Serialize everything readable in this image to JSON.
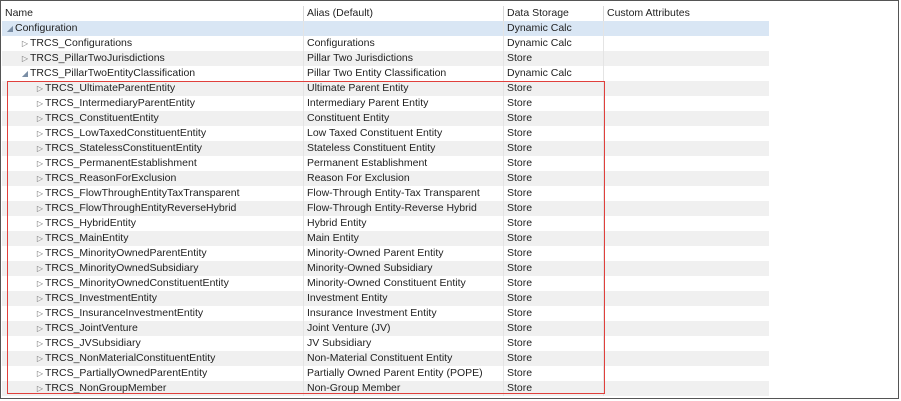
{
  "columns": {
    "name": "Name",
    "alias": "Alias (Default)",
    "storage": "Data Storage",
    "attributes": "Custom Attributes"
  },
  "rows": [
    {
      "name": "Configuration",
      "alias": "",
      "storage": "Dynamic Calc",
      "level": 0,
      "expanded": true
    },
    {
      "name": "TRCS_Configurations",
      "alias": "Configurations",
      "storage": "Dynamic Calc",
      "level": 1,
      "expanded": false
    },
    {
      "name": "TRCS_PillarTwoJurisdictions",
      "alias": "Pillar Two Jurisdictions",
      "storage": "Store",
      "level": 1,
      "expanded": false
    },
    {
      "name": "TRCS_PillarTwoEntityClassification",
      "alias": "Pillar Two Entity Classification",
      "storage": "Dynamic Calc",
      "level": 1,
      "expanded": true
    },
    {
      "name": "TRCS_UltimateParentEntity",
      "alias": "Ultimate Parent Entity",
      "storage": "Store",
      "level": 2,
      "expanded": false
    },
    {
      "name": "TRCS_IntermediaryParentEntity",
      "alias": "Intermediary Parent Entity",
      "storage": "Store",
      "level": 2,
      "expanded": false
    },
    {
      "name": "TRCS_ConstituentEntity",
      "alias": "Constituent Entity",
      "storage": "Store",
      "level": 2,
      "expanded": false
    },
    {
      "name": "TRCS_LowTaxedConstituentEntity",
      "alias": "Low Taxed Constituent Entity",
      "storage": "Store",
      "level": 2,
      "expanded": false
    },
    {
      "name": "TRCS_StatelessConstituentEntity",
      "alias": "Stateless Constituent Entity",
      "storage": "Store",
      "level": 2,
      "expanded": false
    },
    {
      "name": "TRCS_PermanentEstablishment",
      "alias": "Permanent Establishment",
      "storage": "Store",
      "level": 2,
      "expanded": false
    },
    {
      "name": "TRCS_ReasonForExclusion",
      "alias": "Reason For Exclusion",
      "storage": "Store",
      "level": 2,
      "expanded": false
    },
    {
      "name": "TRCS_FlowThroughEntityTaxTransparent",
      "alias": "Flow-Through Entity-Tax Transparent",
      "storage": "Store",
      "level": 2,
      "expanded": false
    },
    {
      "name": "TRCS_FlowThroughEntityReverseHybrid",
      "alias": "Flow-Through Entity-Reverse Hybrid",
      "storage": "Store",
      "level": 2,
      "expanded": false
    },
    {
      "name": "TRCS_HybridEntity",
      "alias": "Hybrid Entity",
      "storage": "Store",
      "level": 2,
      "expanded": false
    },
    {
      "name": "TRCS_MainEntity",
      "alias": "Main Entity",
      "storage": "Store",
      "level": 2,
      "expanded": false
    },
    {
      "name": "TRCS_MinorityOwnedParentEntity",
      "alias": "Minority-Owned Parent Entity",
      "storage": "Store",
      "level": 2,
      "expanded": false
    },
    {
      "name": "TRCS_MinorityOwnedSubsidiary",
      "alias": "Minority-Owned Subsidiary",
      "storage": "Store",
      "level": 2,
      "expanded": false
    },
    {
      "name": "TRCS_MinorityOwnedConstituentEntity",
      "alias": "Minority-Owned Constituent Entity",
      "storage": "Store",
      "level": 2,
      "expanded": false
    },
    {
      "name": "TRCS_InvestmentEntity",
      "alias": "Investment Entity",
      "storage": "Store",
      "level": 2,
      "expanded": false
    },
    {
      "name": "TRCS_InsuranceInvestmentEntity",
      "alias": "Insurance Investment Entity",
      "storage": "Store",
      "level": 2,
      "expanded": false
    },
    {
      "name": "TRCS_JointVenture",
      "alias": "Joint Venture (JV)",
      "storage": "Store",
      "level": 2,
      "expanded": false
    },
    {
      "name": "TRCS_JVSubsidiary",
      "alias": "JV Subsidiary",
      "storage": "Store",
      "level": 2,
      "expanded": false
    },
    {
      "name": "TRCS_NonMaterialConstituentEntity",
      "alias": "Non-Material Constituent Entity",
      "storage": "Store",
      "level": 2,
      "expanded": false
    },
    {
      "name": "TRCS_PartiallyOwnedParentEntity",
      "alias": "Partially Owned Parent Entity (POPE)",
      "storage": "Store",
      "level": 2,
      "expanded": false
    },
    {
      "name": "TRCS_NonGroupMember",
      "alias": "Non-Group Member",
      "storage": "Store",
      "level": 2,
      "expanded": false
    }
  ],
  "icons": {
    "collapsed": "triangle-right-icon",
    "expanded": "triangle-down-icon"
  },
  "colors": {
    "highlight_box": "#e0403c",
    "selected_row": "#d9e6f4",
    "alt_row": "#f0f0f0"
  }
}
